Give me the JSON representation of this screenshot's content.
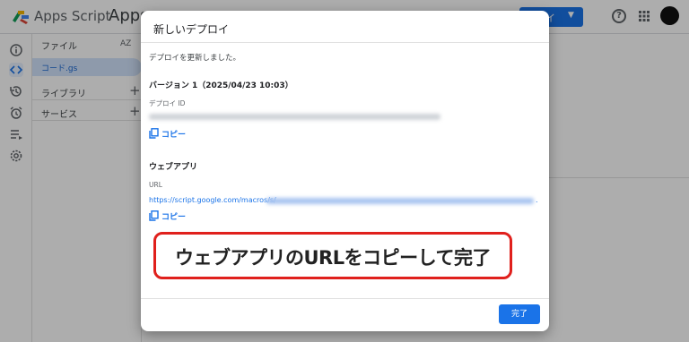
{
  "app": {
    "name": "Apps Script",
    "project_title": "Apps",
    "deploy_label": "ロイ"
  },
  "files_panel": {
    "header": "ファイル",
    "sort_label": "AZ",
    "selected_file": "コード.gs",
    "libraries_label": "ライブラリ",
    "services_label": "サービス",
    "add_symbol": "+"
  },
  "dialog": {
    "title": "新しいデプロイ",
    "message": "デプロイを更新しました。",
    "version": "バージョン 1（2025/04/23 10:03）",
    "deploy_id_label": "デプロイ ID",
    "copy_label": "コピー",
    "webapp_heading": "ウェブアプリ",
    "url_label": "URL",
    "url_prefix": "https://script.google.com/macros/s/",
    "url_suffix": ".",
    "done_label": "完了"
  },
  "annotation": {
    "text": "ウェブアプリのURLをコピーして完了",
    "border_color": "#e0201c"
  },
  "colors": {
    "accent": "#1a73e8",
    "scrim": "rgba(0,0,0,0.32)"
  },
  "icons": [
    "apps-script-logo-icon",
    "help-icon",
    "apps-grid-icon",
    "info-icon",
    "code-icon",
    "history-icon",
    "alarm-icon",
    "executions-icon",
    "settings-icon",
    "copy-icon"
  ]
}
